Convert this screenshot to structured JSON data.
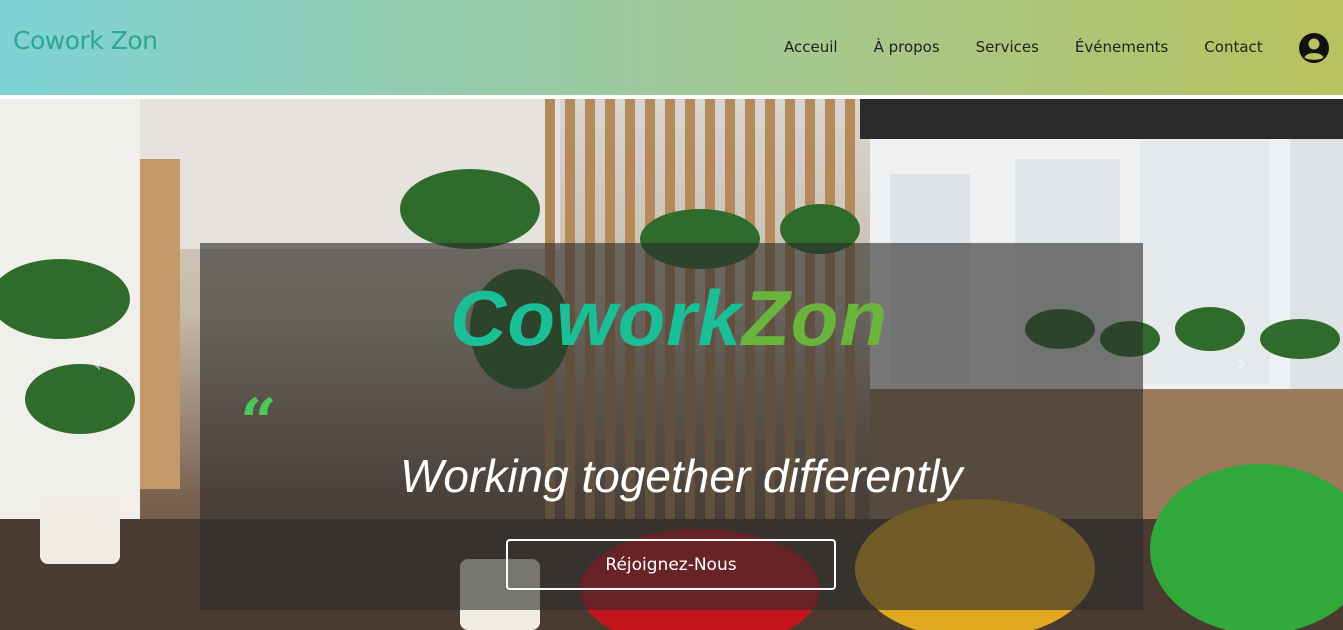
{
  "header": {
    "brand": "Cowork Zon",
    "nav": [
      {
        "label": "Acceuil"
      },
      {
        "label": "À propos"
      },
      {
        "label": "Services"
      },
      {
        "label": "Événements"
      },
      {
        "label": "Contact"
      }
    ],
    "user_icon": "user-circle-icon"
  },
  "hero": {
    "logo_part1": "Cowork",
    "logo_part2": "Zon",
    "quote_mark": "“",
    "tagline": "Working together differently",
    "cta_label": "Réjoignez-Nous",
    "arrows": {
      "prev": "‹",
      "next": "›"
    }
  },
  "colors": {
    "brand": "#2ca88f",
    "logo_teal": "#1bbf97",
    "logo_green": "#6bb43c",
    "quote_green": "#4cc75b"
  }
}
